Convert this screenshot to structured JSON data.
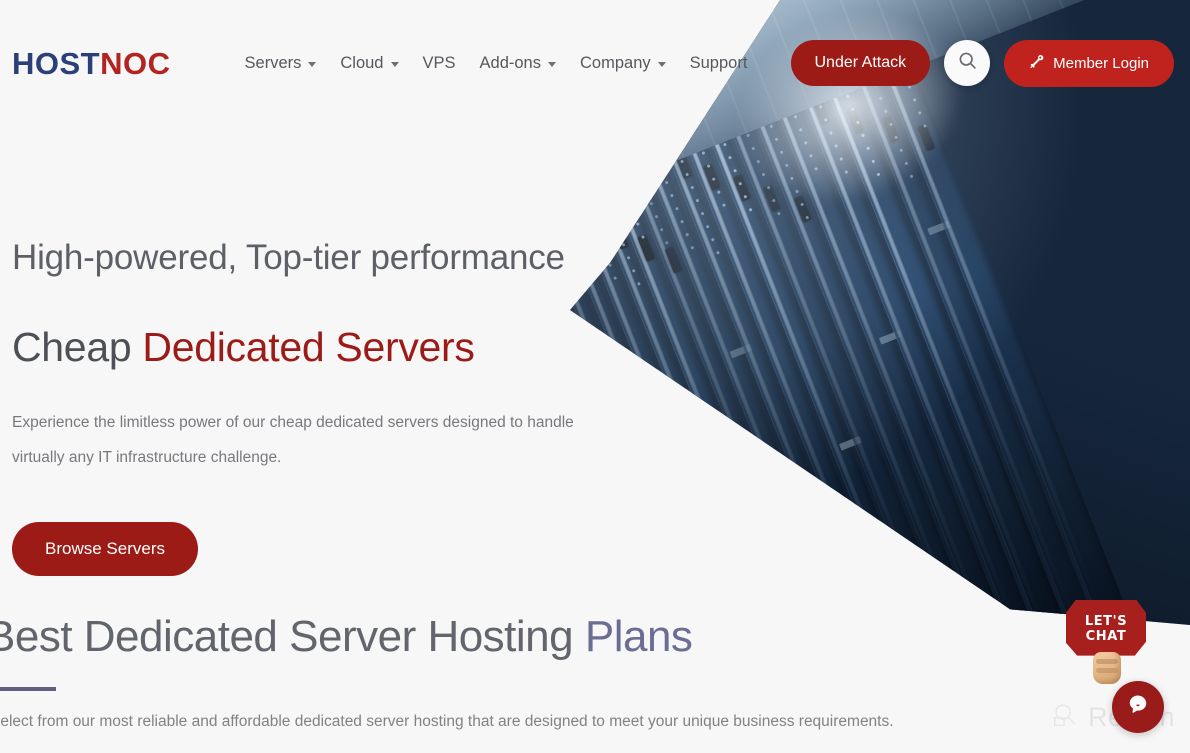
{
  "brand": {
    "logo_first": "HOST",
    "logo_second": "NOC",
    "color_blue": "#2b3f78",
    "color_red": "#b2241f"
  },
  "nav": {
    "items": [
      {
        "label": "Servers",
        "has_caret": true,
        "icon": "chevron-down-icon"
      },
      {
        "label": "Cloud",
        "has_caret": true,
        "icon": "chevron-down-icon"
      },
      {
        "label": "VPS",
        "has_caret": false,
        "icon": ""
      },
      {
        "label": "Add-ons",
        "has_caret": true,
        "icon": "chevron-down-icon"
      },
      {
        "label": "Company",
        "has_caret": true,
        "icon": "chevron-down-icon"
      },
      {
        "label": "Support",
        "has_caret": false,
        "icon": ""
      }
    ],
    "under_attack_label": "Under Attack",
    "search_icon": "search-icon",
    "member_login_label": "Member Login",
    "member_login_icon": "key-icon",
    "under_attack_color": "#9c1b17",
    "member_login_color": "#c0231d"
  },
  "hero": {
    "eyebrow": "High-powered, Top-tier performance",
    "title_plain": "Cheap ",
    "title_accent": "Dedicated Servers",
    "description": "Experience the limitless power of our cheap dedicated servers designed to handle virtually any IT infrastructure challenge.",
    "cta_label": "Browse Servers",
    "cta_color": "#9c1b17",
    "image_alt": "data-center-server-racks"
  },
  "plans": {
    "title_plain": "Best Dedicated Server Hosting ",
    "title_accent": "Plans",
    "accent_color": "#6b6d92",
    "subtitle": "Select from our most reliable and affordable dedicated server hosting that are designed to meet your unique business requirements."
  },
  "widgets": {
    "lets_chat_line1": "LET'S",
    "lets_chat_line2": "CHAT",
    "lets_chat_color": "#a8201d",
    "chat_fab_icon": "chat-bubble-icon",
    "chat_fab_color": "#991c1a",
    "watermark_text": "Revain",
    "watermark_icon": "revain-logo-icon"
  }
}
